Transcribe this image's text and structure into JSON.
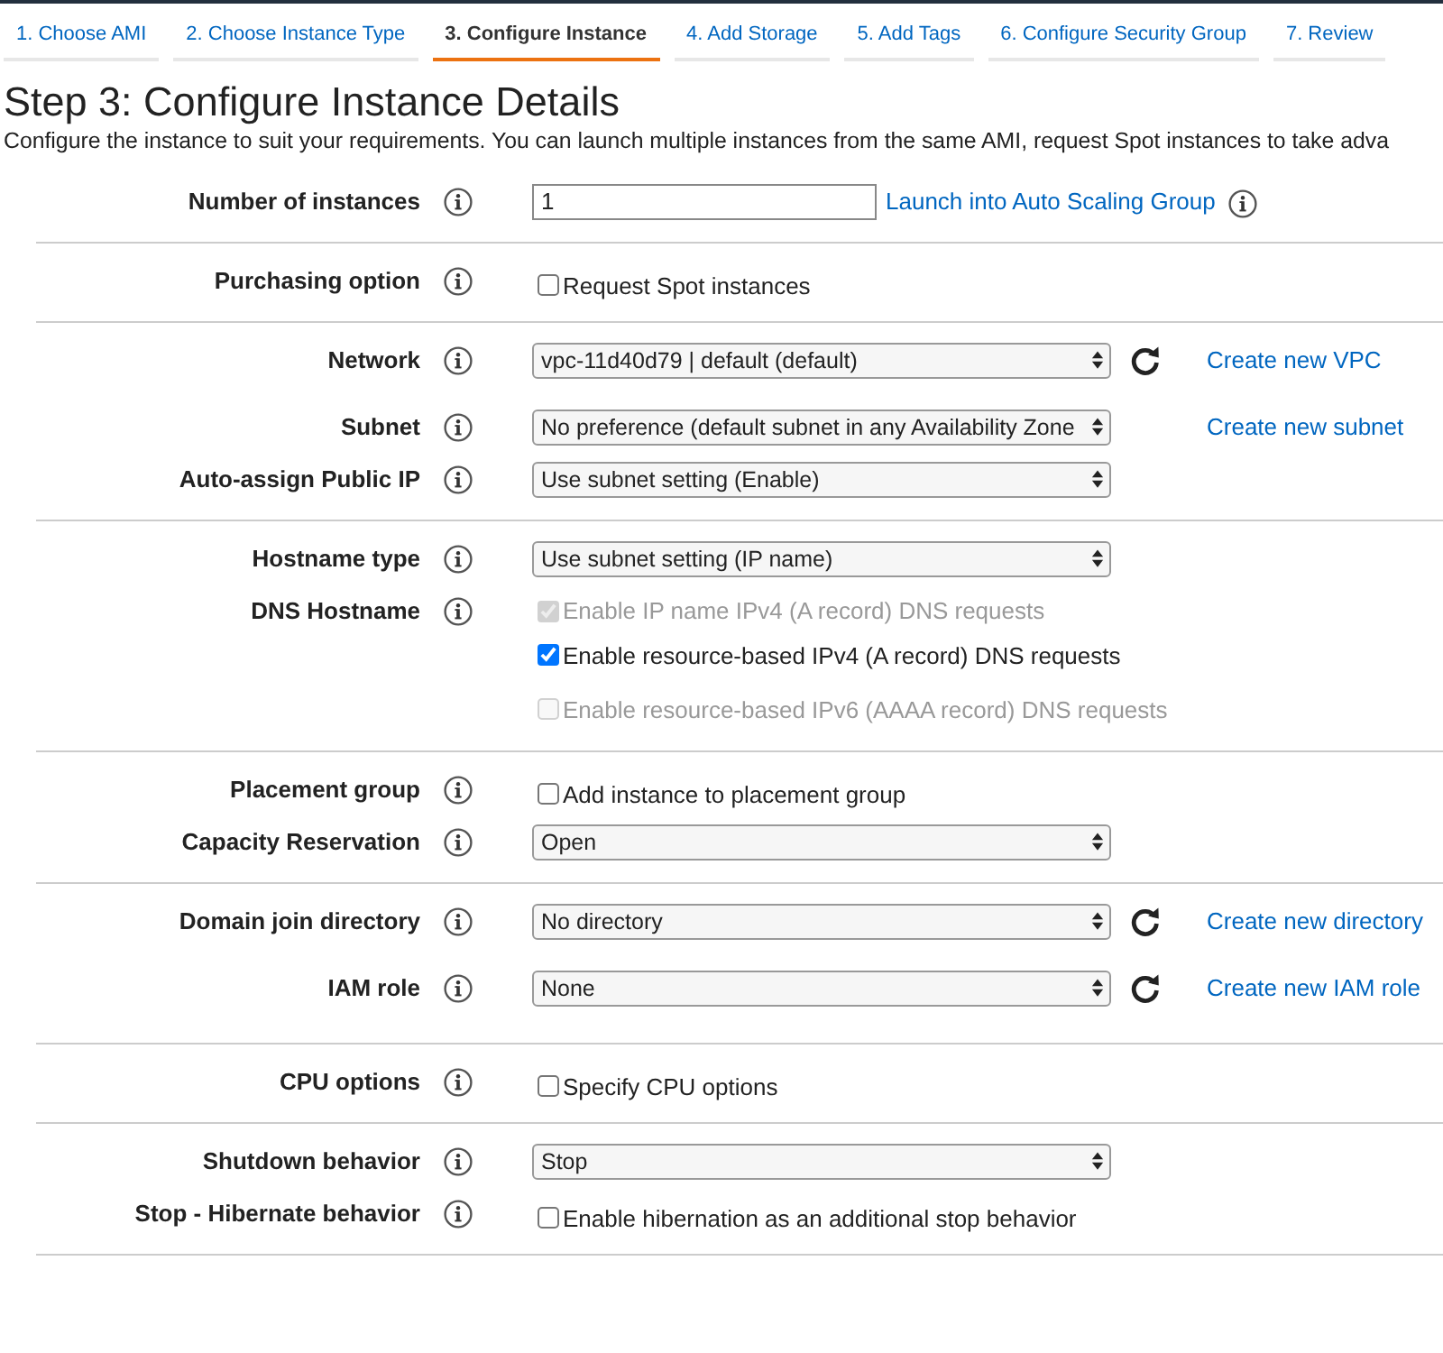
{
  "tabs": [
    {
      "label": "1. Choose AMI",
      "selected": false
    },
    {
      "label": "2. Choose Instance Type",
      "selected": false
    },
    {
      "label": "3. Configure Instance",
      "selected": true
    },
    {
      "label": "4. Add Storage",
      "selected": false
    },
    {
      "label": "5. Add Tags",
      "selected": false
    },
    {
      "label": "6. Configure Security Group",
      "selected": false
    },
    {
      "label": "7. Review",
      "selected": false
    }
  ],
  "title": "Step 3: Configure Instance Details",
  "description": "Configure the instance to suit your requirements. You can launch multiple instances from the same AMI, request Spot instances to take adva",
  "sections": [
    {
      "rows": [
        {
          "label": "Number of instances",
          "kind": "input",
          "value": "1",
          "link": "Launch into Auto Scaling Group",
          "link_info": true
        }
      ]
    },
    {
      "rows": [
        {
          "label": "Purchasing option",
          "kind": "checkboxes",
          "options": [
            {
              "label": "Request Spot instances",
              "checked": false,
              "disabled": false
            }
          ]
        }
      ]
    },
    {
      "rows": [
        {
          "label": "Network",
          "kind": "select",
          "value": "vpc-11d40d79 | default (default)",
          "refresh": true,
          "link": "Create new VPC"
        },
        {
          "label": "Subnet",
          "kind": "select",
          "value": "No preference (default subnet in any Availability Zone",
          "link": "Create new subnet"
        },
        {
          "label": "Auto-assign Public IP",
          "kind": "select",
          "value": "Use subnet setting (Enable)"
        }
      ]
    },
    {
      "rows": [
        {
          "label": "Hostname type",
          "kind": "select",
          "value": "Use subnet setting (IP name)"
        },
        {
          "label": "DNS Hostname",
          "kind": "checkboxes",
          "options": [
            {
              "label": "Enable IP name IPv4 (A record) DNS requests",
              "checked": true,
              "disabled": true
            },
            {
              "label": "Enable resource-based IPv4 (A record) DNS requests",
              "checked": true,
              "disabled": false
            },
            {
              "label": "Enable resource-based IPv6 (AAAA record) DNS requests",
              "checked": false,
              "disabled": true
            }
          ]
        }
      ]
    },
    {
      "rows": [
        {
          "label": "Placement group",
          "kind": "checkboxes",
          "options": [
            {
              "label": "Add instance to placement group",
              "checked": false,
              "disabled": false
            }
          ]
        },
        {
          "label": "Capacity Reservation",
          "kind": "select",
          "value": "Open"
        }
      ]
    },
    {
      "rows": [
        {
          "label": "Domain join directory",
          "kind": "select",
          "value": "No directory",
          "refresh": true,
          "link": "Create new directory"
        },
        {
          "label": "IAM role",
          "kind": "select",
          "value": "None",
          "refresh": true,
          "link": "Create new IAM role"
        }
      ]
    },
    {
      "rows": [
        {
          "label": "CPU options",
          "kind": "checkboxes",
          "options": [
            {
              "label": "Specify CPU options",
              "checked": false,
              "disabled": false
            }
          ]
        }
      ]
    },
    {
      "rows": [
        {
          "label": "Shutdown behavior",
          "kind": "select",
          "value": "Stop"
        },
        {
          "label": "Stop - Hibernate behavior",
          "kind": "checkboxes",
          "options": [
            {
              "label": "Enable hibernation as an additional stop behavior",
              "checked": false,
              "disabled": false
            }
          ]
        }
      ]
    }
  ]
}
